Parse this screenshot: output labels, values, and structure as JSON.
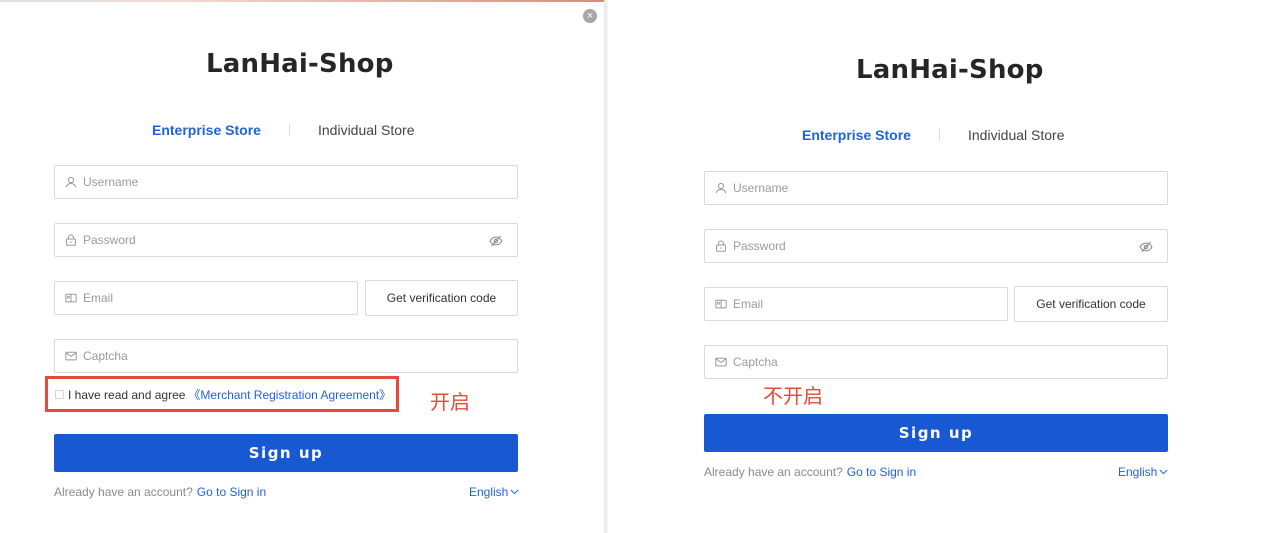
{
  "left": {
    "close_label": "×",
    "title": "LanHai-Shop",
    "tabs": [
      {
        "label": "Enterprise Store",
        "active": true
      },
      {
        "label": "Individual Store",
        "active": false
      }
    ],
    "username": {
      "placeholder": "Username",
      "icon": "user-icon"
    },
    "password": {
      "placeholder": "Password",
      "icon": "lock-icon",
      "toggle_icon": "eye-off-icon"
    },
    "email": {
      "placeholder": "Email",
      "icon": "id-card-icon"
    },
    "code_button": "Get verification code",
    "captcha": {
      "placeholder": "Captcha",
      "icon": "mail-icon"
    },
    "agreement": {
      "prefix": "I have read and agree",
      "link": "《Merchant Registration Agreement》",
      "checked": false
    },
    "annotation": "开启",
    "signup": "Sign up",
    "footer": {
      "question": "Already have an account?",
      "link": "Go to Sign in"
    },
    "language": "English"
  },
  "right": {
    "title": "LanHai-Shop",
    "tabs": [
      {
        "label": "Enterprise Store",
        "active": true
      },
      {
        "label": "Individual Store",
        "active": false
      }
    ],
    "username": {
      "placeholder": "Username",
      "icon": "user-icon"
    },
    "password": {
      "placeholder": "Password",
      "icon": "lock-icon",
      "toggle_icon": "eye-off-icon"
    },
    "email": {
      "placeholder": "Email",
      "icon": "id-card-icon"
    },
    "code_button": "Get verification code",
    "captcha": {
      "placeholder": "Captcha",
      "icon": "mail-icon"
    },
    "annotation": "不开启",
    "signup": "Sign up",
    "footer": {
      "question": "Already have an account?",
      "link": "Go to Sign in"
    },
    "language": "English"
  },
  "colors": {
    "accent": "#1f63d8",
    "primary_button": "#1859d3",
    "annotation_red": "#e74a3b",
    "placeholder": "#9b9b9b"
  }
}
